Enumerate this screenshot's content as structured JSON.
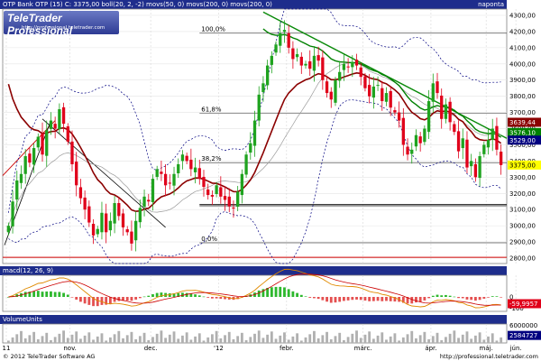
{
  "header": {
    "main_title": "OTP Bank OTP (15) C: 3375,00 boll(20, 2, -2) movs(50, 0) movs(200, 0) movs(200, 0)",
    "period_label": "naponta",
    "macd_title": "macd(12, 26, 9)",
    "volume_title": "VolumeUnits"
  },
  "logo": {
    "name": "TeleTrader Professional",
    "url": "http://professional.teletrader.com"
  },
  "footer": {
    "copyright": "© 2012 TeleTrader Software AG",
    "url": "http://professional.teletrader.com"
  },
  "colors": {
    "header_bg": "#1e2d8c",
    "candle_up": "#1fa31f",
    "candle_down": "#e0001a",
    "ma50": "#8b0000",
    "ma200": "#008000",
    "bollinger": "#000080",
    "fib": "#333333"
  },
  "chart_data": [
    {
      "type": "candlestick",
      "title": "OTP Bank OTP (15) C: 3375,00",
      "ylim": [
        2800,
        4300
      ],
      "y_ticks": [
        "4300,00",
        "4200,00",
        "4100,00",
        "4000,00",
        "3900,00",
        "3800,00",
        "3700,00",
        "3600,00",
        "3500,00",
        "3400,00",
        "3300,00",
        "3200,00",
        "3100,00",
        "3000,00",
        "2900,00",
        "2800,00"
      ],
      "x_tick_labels": [
        "11",
        "nov.",
        "dec.",
        "'12",
        "febr.",
        "márc.",
        "ápr.",
        "máj.",
        "jún."
      ],
      "price_labels": [
        {
          "value": "3639,44",
          "color": "#8b0000"
        },
        {
          "value": "3576,10",
          "color": "#008000"
        },
        {
          "value": "3529,00",
          "color": "#000080"
        },
        {
          "value": "3375,00",
          "color": "#ffff00"
        }
      ],
      "fibonacci_levels": [
        "100,0%",
        "61,8%",
        "38,2%",
        "0,0%"
      ],
      "closes": [
        3000,
        3150,
        3280,
        3320,
        3430,
        3390,
        3480,
        3550,
        3440,
        3590,
        3650,
        3600,
        3720,
        3630,
        3520,
        3380,
        3250,
        3170,
        3100,
        3020,
        2940,
        2980,
        3080,
        2960,
        3030,
        3140,
        3060,
        2990,
        2960,
        2890,
        3030,
        3110,
        3180,
        3150,
        3290,
        3350,
        3320,
        3250,
        3260,
        3320,
        3380,
        3440,
        3400,
        3350,
        3360,
        3290,
        3240,
        3190,
        3180,
        3250,
        3180,
        3160,
        3120,
        3110,
        3210,
        3320,
        3440,
        3510,
        3650,
        3810,
        3880,
        3990,
        4050,
        4120,
        4190,
        4210,
        4100,
        4030,
        4060,
        3990,
        4000,
        3970,
        4050,
        4020,
        3900,
        3820,
        3780,
        3900,
        3950,
        4000,
        3980,
        4010,
        3990,
        3920,
        3850,
        3800,
        3860,
        3870,
        3770,
        3820,
        3730,
        3700,
        3650,
        3500,
        3440,
        3470,
        3560,
        3510,
        3600,
        3770,
        3880,
        3820,
        3660,
        3750,
        3640,
        3580,
        3460,
        3540,
        3360,
        3400,
        3300,
        3430,
        3500,
        3530,
        3600,
        3470,
        3375
      ],
      "series": [
        {
          "name": "movs(50, 0)",
          "type": "line"
        },
        {
          "name": "movs(200, 0)",
          "type": "line"
        },
        {
          "name": "boll(20, 2, -2)",
          "type": "band"
        }
      ]
    },
    {
      "type": "bar",
      "title": "macd(12, 26, 9)",
      "y_ticks": [
        "0",
        "-100"
      ],
      "last_value": "-59,9957"
    },
    {
      "type": "bar",
      "title": "VolumeUnits",
      "y_ticks": [
        "6000000",
        "2584727"
      ],
      "last_value": "2584727"
    }
  ]
}
